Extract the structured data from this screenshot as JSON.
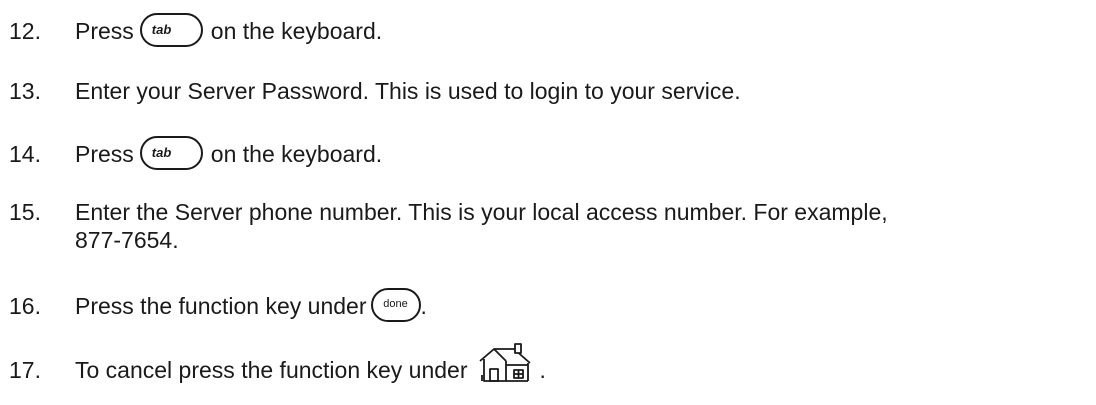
{
  "steps": [
    {
      "num": "12.",
      "before": "Press",
      "key": "tab",
      "after": "on the keyboard."
    },
    {
      "num": "13.",
      "text": "Enter your Server Password. This is used to login to your service."
    },
    {
      "num": "14.",
      "before": "Press",
      "key": "tab",
      "after": "on the keyboard."
    },
    {
      "num": "15.",
      "line1": "Enter the Server phone number. This is your local access number. For example,",
      "line2": "877-7654."
    },
    {
      "num": "16.",
      "before": "Press the function key under",
      "key": "done",
      "after": "."
    },
    {
      "num": "17.",
      "before": "To cancel press the function key under",
      "icon": "home-icon",
      "after": "."
    }
  ]
}
